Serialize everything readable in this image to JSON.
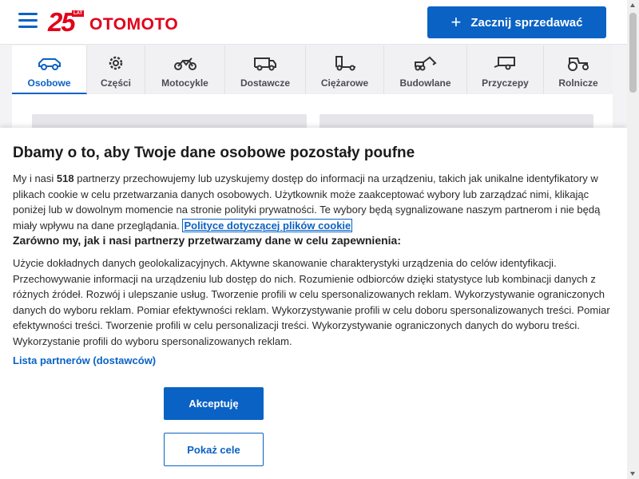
{
  "header": {
    "logo": {
      "years": "25",
      "lat": "LAT",
      "brand": "OTOMOTO"
    },
    "sell_button": "Zacznij sprzedawać"
  },
  "categories": [
    {
      "label": "Osobowe",
      "icon": "car-icon",
      "active": true
    },
    {
      "label": "Części",
      "icon": "gear-icon",
      "active": false
    },
    {
      "label": "Motocykle",
      "icon": "motorcycle-icon",
      "active": false
    },
    {
      "label": "Dostawcze",
      "icon": "van-icon",
      "active": false
    },
    {
      "label": "Ciężarowe",
      "icon": "truck-icon",
      "active": false
    },
    {
      "label": "Budowlane",
      "icon": "excavator-icon",
      "active": false
    },
    {
      "label": "Przyczepy",
      "icon": "trailer-icon",
      "active": false
    },
    {
      "label": "Rolnicze",
      "icon": "tractor-icon",
      "active": false
    }
  ],
  "consent": {
    "title": "Dbamy o to, aby Twoje dane osobowe pozostały poufne",
    "intro_before": "My i nasi ",
    "partners_count": "518",
    "intro_after": " partnerzy przechowujemy lub uzyskujemy dostęp do informacji na urządzeniu, takich jak unikalne identyfikatory w plikach cookie w celu przetwarzania danych osobowych. Użytkownik może zaakceptować wybory lub zarządzać nimi, klikając poniżej lub w dowolnym momencie na stronie polityki prywatności. Te wybory będą sygnalizowane naszym partnerom i nie będą miały wpływu na dane przeglądania. ",
    "cookie_policy_link": "Polityce dotyczącej plików cookie",
    "purposes_heading": "Zarówno my, jak i nasi partnerzy przetwarzamy dane w celu zapewnienia:",
    "purposes_text": "Użycie dokładnych danych geolokalizacyjnych. Aktywne skanowanie charakterystyki urządzenia do celów identyfikacji. Przechowywanie informacji na urządzeniu lub dostęp do nich. Rozumienie odbiorców dzięki statystyce lub kombinacji danych z różnych źródeł. Rozwój i ulepszanie usług. Tworzenie profili w celu spersonalizowanych reklam. Wykorzystywanie ograniczonych danych do wyboru reklam. Pomiar efektywności reklam. Wykorzystywanie profili w celu doboru spersonalizowanych treści. Pomiar efektywności treści. Tworzenie profili w celu personalizacji treści. Wykorzystywanie ograniczonych danych do wyboru treści. Wykorzystanie profili do wyboru spersonalizowanych reklam.",
    "partners_list_link": "Lista partnerów (dostawców)",
    "accept_button": "Akceptuję",
    "show_purposes_button": "Pokaż cele"
  },
  "colors": {
    "accent": "#0a62c4",
    "brand_red": "#e2001a"
  }
}
